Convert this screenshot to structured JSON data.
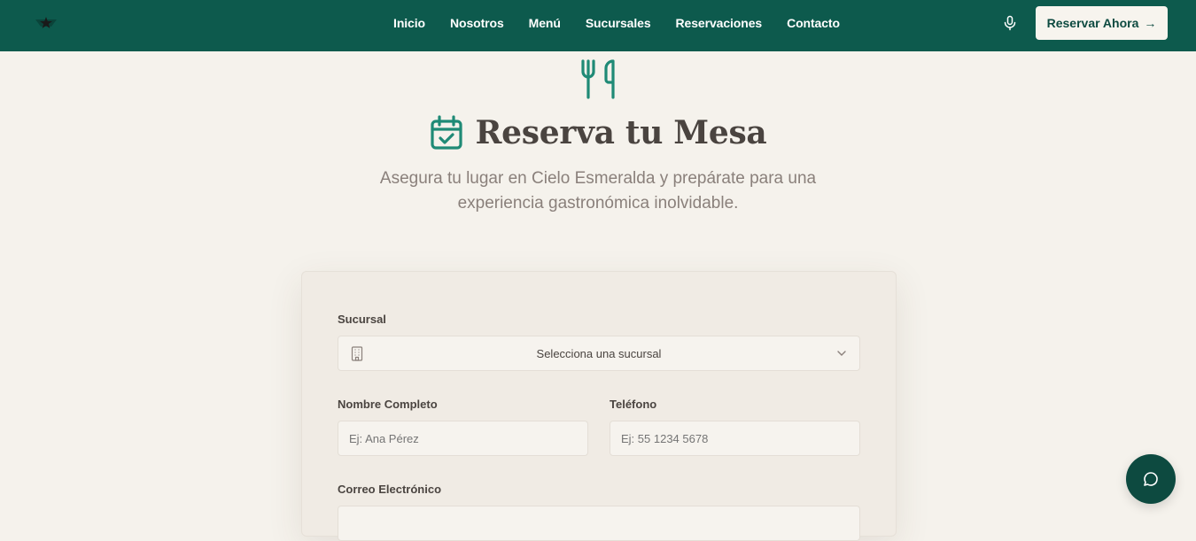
{
  "header": {
    "nav": [
      "Inicio",
      "Nosotros",
      "Menú",
      "Sucursales",
      "Reservaciones",
      "Contacto"
    ],
    "reserve_button": "Reservar Ahora",
    "reserve_arrow": "→",
    "icons": {
      "logo": "star-logo-icon",
      "mic": "microphone-icon"
    }
  },
  "hero": {
    "title": "Reserva tu Mesa",
    "subtitle": "Asegura tu lugar en Cielo Esmeralda y prepárate para una experiencia gastronómica inolvidable.",
    "icons": {
      "top": "fork-knife-icon",
      "title": "calendar-check-icon"
    }
  },
  "form": {
    "branch": {
      "label": "Sucursal",
      "value": "Selecciona una sucursal"
    },
    "name": {
      "label": "Nombre Completo",
      "placeholder": "Ej: Ana Pérez"
    },
    "phone": {
      "label": "Teléfono",
      "placeholder": "Ej: 55 1234 5678"
    },
    "email": {
      "label": "Correo Electrónico"
    }
  },
  "colors": {
    "header_bg": "#0d5a4d",
    "accent": "#1f8a76",
    "page_bg": "#f5f2ec",
    "chat_bg": "#0d4a40"
  },
  "chat": {
    "icon": "chat-bubble-icon"
  }
}
